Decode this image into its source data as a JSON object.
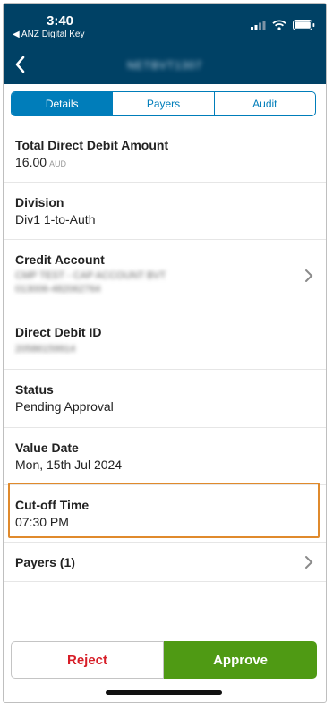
{
  "status_bar": {
    "time": "3:40",
    "back_app": "◀ ANZ Digital Key"
  },
  "nav": {
    "title": "NETBVT1307"
  },
  "tabs": [
    {
      "label": "Details",
      "active": true
    },
    {
      "label": "Payers",
      "active": false
    },
    {
      "label": "Audit",
      "active": false
    }
  ],
  "fields": {
    "total": {
      "label": "Total Direct Debit Amount",
      "value": "16.00",
      "unit": "AUD"
    },
    "division": {
      "label": "Division",
      "value": "Div1 1-to-Auth"
    },
    "credit": {
      "label": "Credit Account",
      "line1": "CMP TEST - CAP ACCOUNT BVT",
      "line2": "013006-482062764"
    },
    "ddid": {
      "label": "Direct Debit ID",
      "value": "20586159914"
    },
    "status": {
      "label": "Status",
      "value": "Pending Approval"
    },
    "value_date": {
      "label": "Value Date",
      "value": "Mon, 15th Jul 2024"
    },
    "cutoff": {
      "label": "Cut-off Time",
      "value": "07:30 PM"
    },
    "payers": {
      "label": "Payers (1)"
    }
  },
  "actions": {
    "reject": "Reject",
    "approve": "Approve"
  },
  "colors": {
    "header": "#004165",
    "accent": "#007dba",
    "reject": "#d71e28",
    "approve": "#4f9a14",
    "highlight": "#e08a2c"
  }
}
